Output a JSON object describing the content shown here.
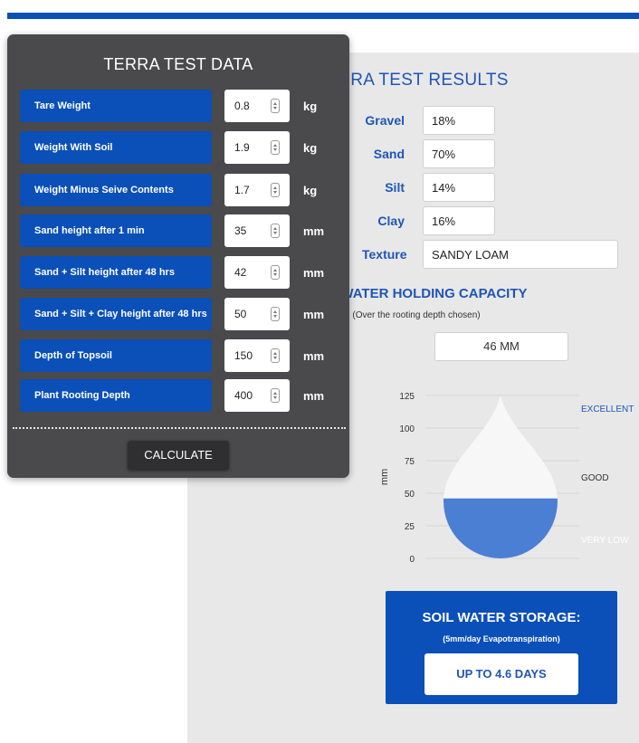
{
  "data_panel": {
    "title": "TERRA TEST DATA",
    "rows": [
      {
        "label": "Tare Weight",
        "value": "0.8",
        "unit": "kg"
      },
      {
        "label": "Weight With Soil",
        "value": "1.9",
        "unit": "kg"
      },
      {
        "label": "Weight Minus Seive Contents",
        "value": "1.7",
        "unit": "kg"
      },
      {
        "label": "Sand height after 1 min",
        "value": "35",
        "unit": "mm"
      },
      {
        "label": "Sand + Silt height after 48 hrs",
        "value": "42",
        "unit": "mm"
      },
      {
        "label": "Sand + Silt + Clay height after 48 hrs",
        "value": "50",
        "unit": "mm"
      },
      {
        "label": "Depth of Topsoil",
        "value": "150",
        "unit": "mm"
      },
      {
        "label": "Plant Rooting Depth",
        "value": "400",
        "unit": "mm"
      }
    ],
    "calculate_label": "CALCULATE"
  },
  "results": {
    "title": "TERRA TEST RESULTS",
    "rows": [
      {
        "label": "Gravel",
        "value": "18%"
      },
      {
        "label": "Sand",
        "value": "70%"
      },
      {
        "label": "Silt",
        "value": "14%"
      },
      {
        "label": "Clay",
        "value": "16%"
      },
      {
        "label": "Texture",
        "value": "SANDY LOAM"
      }
    ],
    "swhc_title": "SOIL WATER HOLDING CAPACITY",
    "swhc_sub": "(Over the rooting depth chosen)",
    "swhc_value": "46 MM"
  },
  "storage": {
    "title": "SOIL WATER STORAGE:",
    "sub": "(5mm/day Evapotranspiration)",
    "value": "UP TO 4.6 DAYS"
  },
  "colors": {
    "accent": "#0b4fb8",
    "fill": "#4a7fd4",
    "panel_dark": "#4a494b"
  },
  "chart_data": {
    "type": "area",
    "ylabel": "mm",
    "ylim": [
      0,
      125
    ],
    "yticks": [
      0,
      25,
      50,
      75,
      100,
      125
    ],
    "value": 46,
    "bands": [
      {
        "label": "EXCELLENT",
        "from": 100,
        "to": 125,
        "color": "#1f55b5"
      },
      {
        "label": "GOOD",
        "from": 25,
        "to": 100,
        "color": "#333333"
      },
      {
        "label": "VERY LOW",
        "from": 0,
        "to": 25,
        "color": "#ffffff"
      }
    ]
  }
}
